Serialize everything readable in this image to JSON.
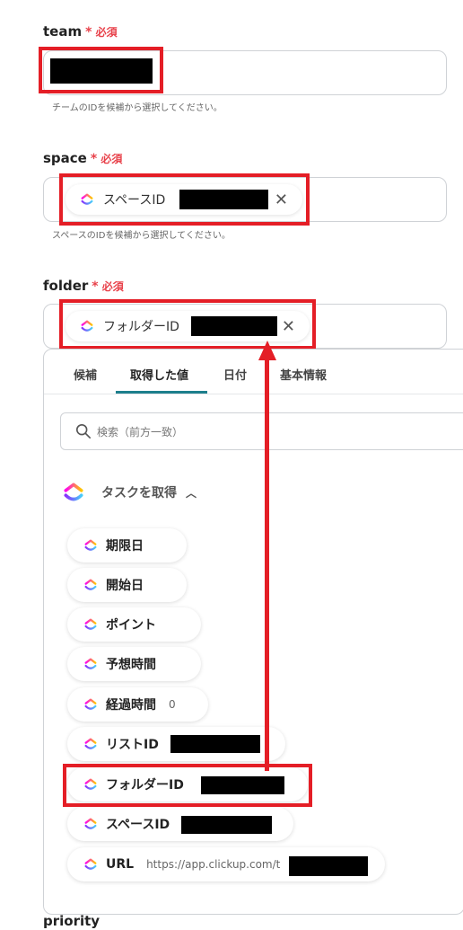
{
  "required_text": "必須",
  "team": {
    "label": "team",
    "help": "チームのIDを候補から選択してください。"
  },
  "space": {
    "label": "space",
    "chip_label": "スペースID",
    "help": "スペースのIDを候補から選択してください。"
  },
  "folder": {
    "label": "folder",
    "chip_label": "フォルダーID"
  },
  "tabs": [
    "候補",
    "取得した値",
    "日付",
    "基本情報"
  ],
  "search": {
    "placeholder": "検索（前方一致）"
  },
  "group": {
    "label": "タスクを取得"
  },
  "items": [
    {
      "label": "期限日"
    },
    {
      "label": "開始日"
    },
    {
      "label": "ポイント"
    },
    {
      "label": "予想時間"
    },
    {
      "label": "経過時間",
      "value": "0"
    },
    {
      "label": "リストID"
    },
    {
      "label": "フォルダーID"
    },
    {
      "label": "スペースID"
    },
    {
      "label": "URL",
      "value": "https://app.clickup.com/t"
    }
  ],
  "priority": {
    "label": "priority"
  },
  "colors": {
    "accent_red": "#e41e26",
    "required": "#e8424b",
    "tab_underline": "#1d7f8c"
  },
  "icons": {
    "clickup": "clickup-logo-icon",
    "remove": "close-icon",
    "search": "search-icon",
    "collapse": "chevron-up-icon"
  }
}
